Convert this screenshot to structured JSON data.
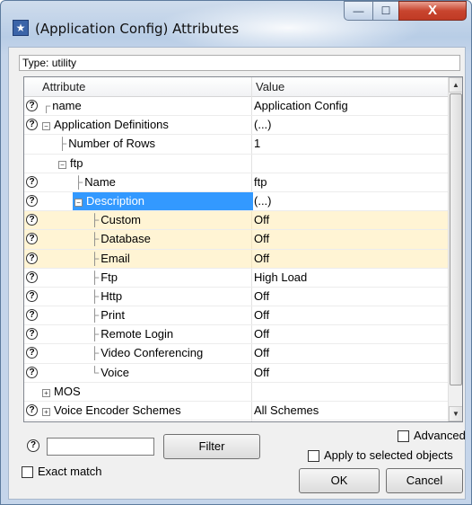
{
  "window": {
    "title": "(Application Config) Attributes",
    "icon": "star-icon"
  },
  "controls": {
    "minimize": "—",
    "maximize": "☐",
    "close": "X"
  },
  "type_field": {
    "label": "Type:",
    "value": "utility"
  },
  "grid": {
    "headers": [
      "Attribute",
      "Value"
    ],
    "rows": [
      {
        "attr": "name",
        "value": "Application Config"
      },
      {
        "attr": "Application Definitions",
        "value": "(...)"
      },
      {
        "attr": "Number of Rows",
        "value": "1"
      },
      {
        "attr": "ftp",
        "value": ""
      },
      {
        "attr": "Name",
        "value": "ftp"
      },
      {
        "attr": "Description",
        "value": "(...)"
      },
      {
        "attr": "Custom",
        "value": "Off"
      },
      {
        "attr": "Database",
        "value": "Off"
      },
      {
        "attr": "Email",
        "value": "Off"
      },
      {
        "attr": "Ftp",
        "value": "High Load"
      },
      {
        "attr": "Http",
        "value": "Off"
      },
      {
        "attr": "Print",
        "value": "Off"
      },
      {
        "attr": "Remote Login",
        "value": "Off"
      },
      {
        "attr": "Video Conferencing",
        "value": "Off"
      },
      {
        "attr": "Voice",
        "value": "Off"
      },
      {
        "attr": "MOS",
        "value": ""
      },
      {
        "attr": "Voice Encoder Schemes",
        "value": "All Schemes"
      }
    ]
  },
  "footer": {
    "help": "?",
    "filter_button": "Filter",
    "exact_match": "Exact match",
    "advanced": "Advanced",
    "apply_selected": "Apply to selected objects",
    "ok": "OK",
    "cancel": "Cancel"
  }
}
